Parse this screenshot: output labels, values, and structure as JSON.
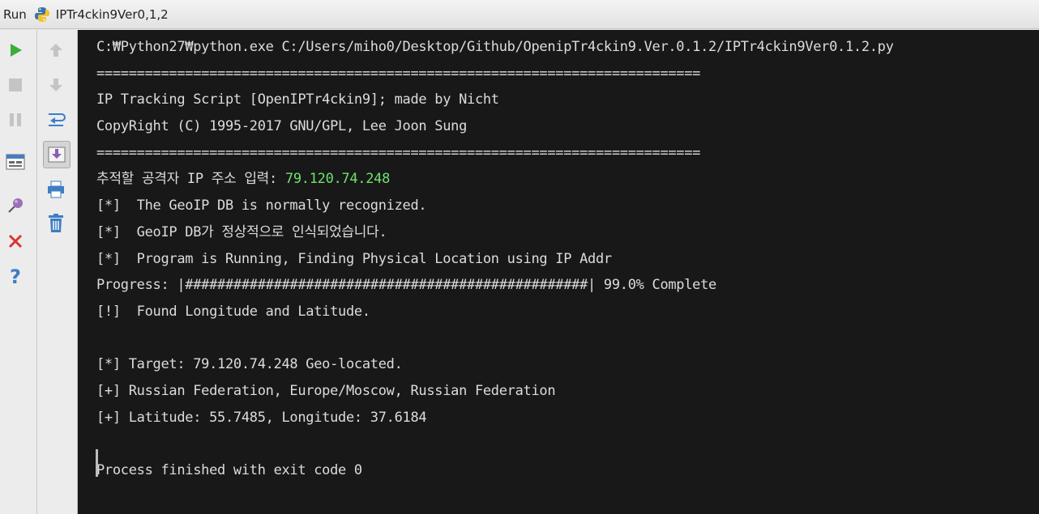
{
  "window": {
    "run_label": "Run",
    "config_name": "IPTr4ckin9Ver0,1,2"
  },
  "toolbar_left": {
    "buttons": [
      "rerun-icon",
      "stop-icon",
      "pause-icon",
      "restore-layout-icon",
      "pin-icon",
      "close-icon",
      "help-icon"
    ]
  },
  "toolbar_right": {
    "buttons": [
      "up-arrow-icon",
      "down-arrow-icon",
      "soft-wrap-icon",
      "scroll-to-end-icon",
      "print-icon",
      "clear-all-icon"
    ]
  },
  "console": {
    "lines": [
      "C:₩Python27₩python.exe C:/Users/miho0/Desktop/Github/OpenipTr4ckin9.Ver.0.1.2/IPTr4ckin9Ver0.1.2.py",
      "===========================================================================",
      "IP Tracking Script [OpenIPTr4ckin9]; made by Nicht",
      "CopyRight (C) 1995-2017 GNU/GPL, Lee Joon Sung",
      "===========================================================================",
      "",
      "[*]  The GeoIP DB is normally recognized.",
      "[*]  GeoIP DB가 정상적으로 인식되었습니다.",
      "[*]  Program is Running, Finding Physical Location using IP Addr",
      "Progress: |##################################################| 99.0% Complete",
      "[!]  Found Longitude and Latitude.",
      "",
      "[*] Target: 79.120.74.248 Geo-located.",
      "[+] Russian Federation, Europe/Moscow, Russian Federation",
      "[+] Latitude: 55.7485, Longitude: 37.6184",
      "",
      "Process finished with exit code 0"
    ],
    "prompt_label": "추적할 공격자 IP 주소 입력: ",
    "prompt_input": "79.120.74.248",
    "progress_percent": 99.0
  },
  "colors": {
    "console_bg": "#181818",
    "console_text": "#dcdcdc",
    "input_text": "#6fe06f"
  }
}
